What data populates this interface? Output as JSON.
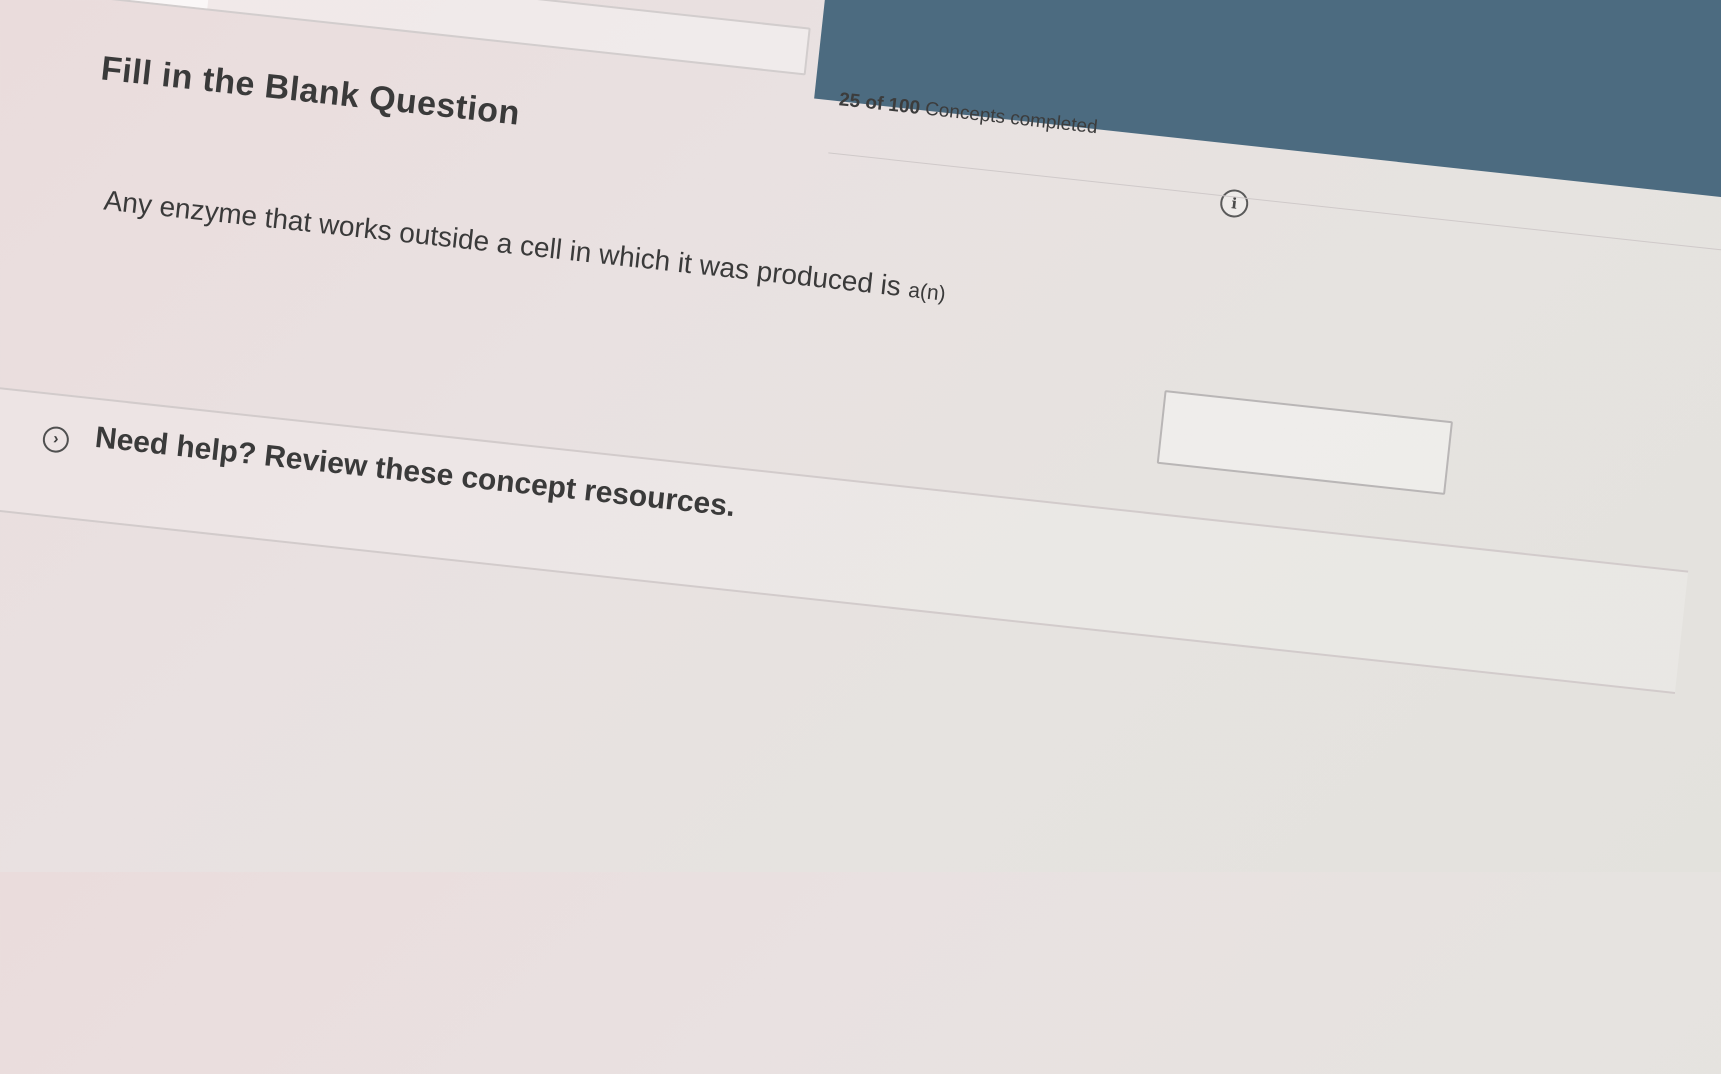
{
  "progress": {
    "completed": "25",
    "of_label": "of",
    "total": "100",
    "suffix": "Concepts completed",
    "fraction": 0.25
  },
  "info_icon_glyph": "i",
  "question": {
    "title": "Fill in the Blank Question",
    "prompt": "Any enzyme that works outside a cell in which it was produced is",
    "prompt_suffix": "a(n)",
    "answer_value": "",
    "answer_placeholder": ""
  },
  "help": {
    "toggle_glyph": "›",
    "label": "Need help? Review these concept resources."
  },
  "colors": {
    "header_band": "#4c6b80",
    "text": "#3a3a3a"
  }
}
